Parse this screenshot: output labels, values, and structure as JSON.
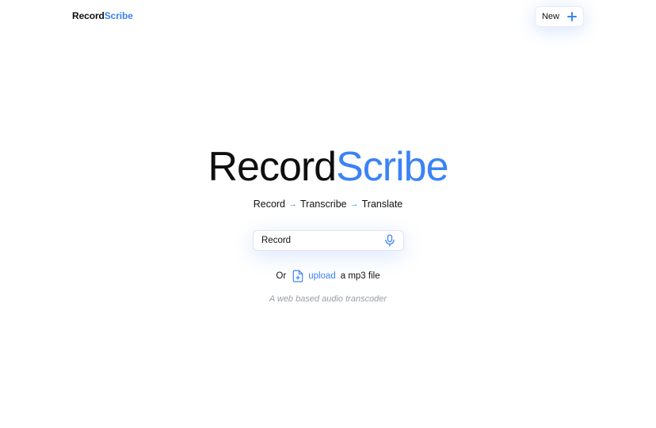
{
  "header": {
    "brand_primary": "Record",
    "brand_accent": "Scribe",
    "new_label": "New"
  },
  "hero": {
    "title_primary": "Record",
    "title_accent": "Scribe",
    "steps": [
      "Record",
      "Transcribe",
      "Translate"
    ],
    "arrow": "→"
  },
  "recorder": {
    "label": "Record",
    "icon": "microphone-icon"
  },
  "upload": {
    "prefix": "Or",
    "icon": "file-plus-icon",
    "link": "upload",
    "suffix": "a mp3 file"
  },
  "subtitle": "A web based audio transcoder",
  "colors": {
    "accent": "#3b82f6",
    "text": "#0f0f0f",
    "muted": "#9aa0a8"
  }
}
